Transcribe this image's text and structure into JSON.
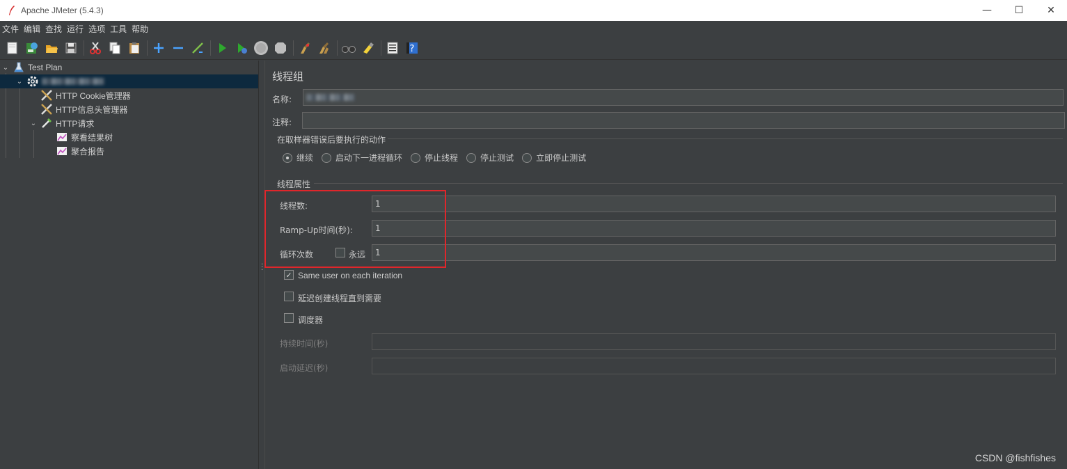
{
  "window": {
    "title": "Apache JMeter (5.4.3)",
    "controls": [
      "—",
      "☐",
      "✕"
    ]
  },
  "menu": [
    "文件",
    "编辑",
    "查找",
    "运行",
    "选项",
    "工具",
    "帮助"
  ],
  "toolbar": {
    "icons": [
      "new-icon",
      "templates-icon",
      "open-icon",
      "save-icon",
      "cut-icon",
      "copy-icon",
      "paste-icon",
      "expand-icon",
      "collapse-icon",
      "toggle-icon",
      "start-icon",
      "start-no-pauses-icon",
      "stop-icon",
      "shutdown-icon",
      "clear-icon",
      "clear-all-icon",
      "search-icon",
      "reset-search-icon",
      "function-helper-icon",
      "help-icon"
    ]
  },
  "tree": {
    "items": [
      {
        "label": "Test Plan",
        "icon": "flask-icon"
      },
      {
        "label": "",
        "icon": "gear-icon"
      },
      {
        "label": "HTTP Cookie管理器",
        "icon": "wrench-icon"
      },
      {
        "label": "HTTP信息头管理器",
        "icon": "wrench-icon"
      },
      {
        "label": "HTTP请求",
        "icon": "pipette-icon"
      },
      {
        "label": "察看结果树",
        "icon": "graph-icon"
      },
      {
        "label": "聚合报告",
        "icon": "graph-icon"
      }
    ]
  },
  "panel": {
    "title": "线程组",
    "name_label": "名称:",
    "name_value": "",
    "comment_label": "注释:",
    "comment_value": "",
    "sampler_error_section": "在取样器错误后要执行的动作",
    "error_actions": [
      {
        "label": "继续",
        "checked": true
      },
      {
        "label": "启动下一进程循环",
        "checked": false
      },
      {
        "label": "停止线程",
        "checked": false
      },
      {
        "label": "停止测试",
        "checked": false
      },
      {
        "label": "立即停止测试",
        "checked": false
      }
    ],
    "thread_props_section": "线程属性",
    "threads_label": "线程数:",
    "threads_value": "1",
    "rampup_label": "Ramp-Up时间(秒):",
    "rampup_value": "1",
    "loop_label": "循环次数",
    "forever_label": "永远",
    "forever_checked": false,
    "loop_value": "1",
    "same_user_label": "Same user on each iteration",
    "same_user_checked": true,
    "delay_label": "延迟创建线程直到需要",
    "delay_checked": false,
    "scheduler_label": "调度器",
    "scheduler_checked": false,
    "duration_label": "持续时间(秒)",
    "duration_value": "",
    "startup_delay_label": "启动延迟(秒)",
    "startup_delay_value": ""
  },
  "watermark": "CSDN @fishfishes",
  "colors": {
    "background": "#3c3f41",
    "selection": "#0d293e",
    "highlight_box": "#e0262b"
  }
}
